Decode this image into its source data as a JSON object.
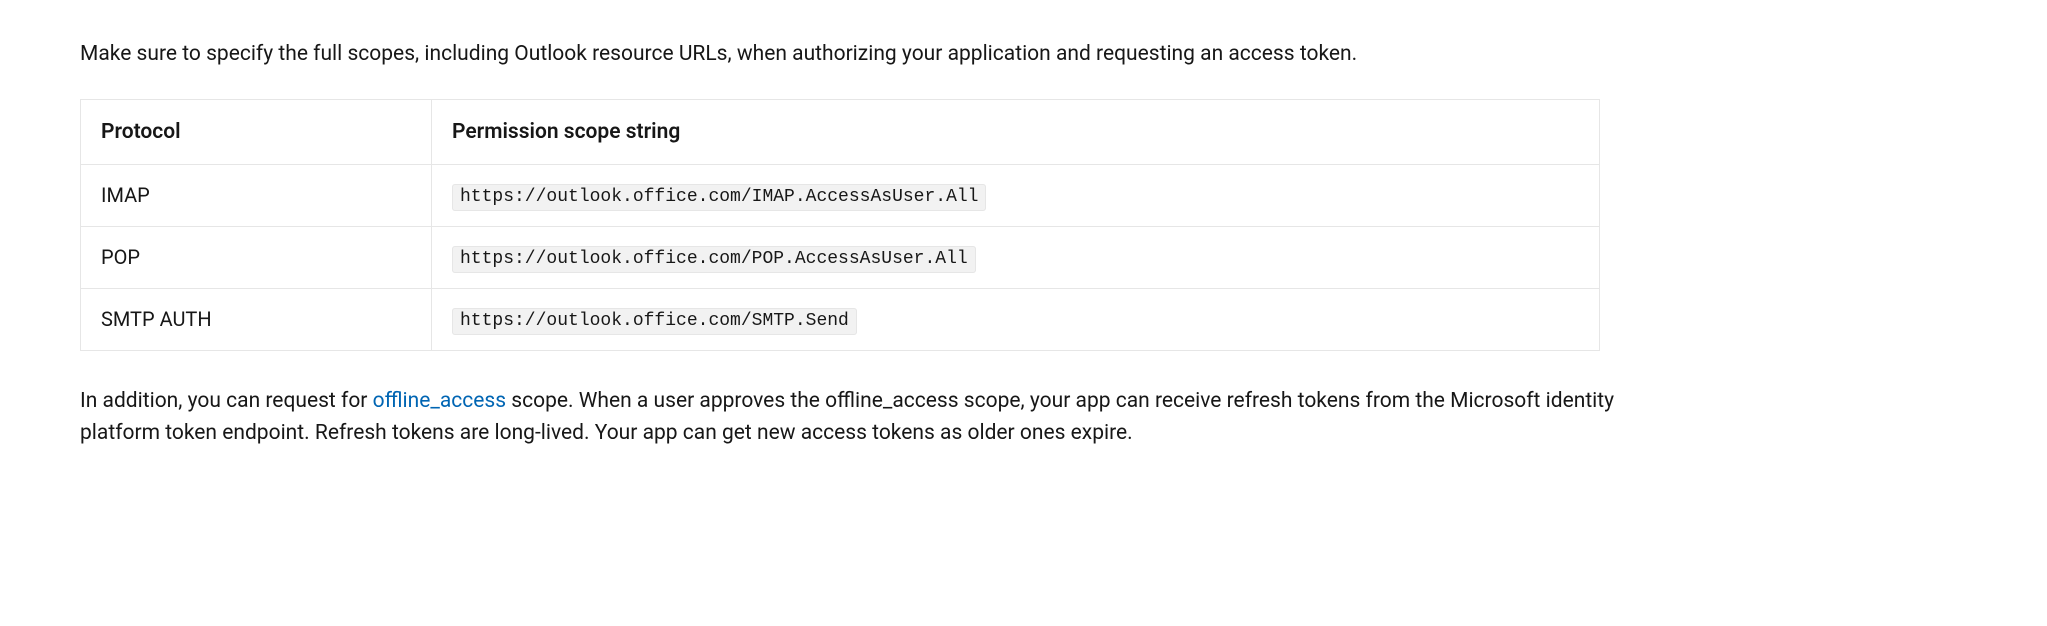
{
  "intro": "Make sure to specify the full scopes, including Outlook resource URLs, when authorizing your application and requesting an access token.",
  "table": {
    "headers": {
      "protocol": "Protocol",
      "scope": "Permission scope string"
    },
    "rows": [
      {
        "protocol": "IMAP",
        "scope": "https://outlook.office.com/IMAP.AccessAsUser.All"
      },
      {
        "protocol": "POP",
        "scope": "https://outlook.office.com/POP.AccessAsUser.All"
      },
      {
        "protocol": "SMTP AUTH",
        "scope": "https://outlook.office.com/SMTP.Send"
      }
    ]
  },
  "outro": {
    "pre_link": "In addition, you can request for ",
    "link_text": "offline_access",
    "link_href": "#",
    "post_link": " scope. When a user approves the offline_access scope, your app can receive refresh tokens from the Microsoft identity platform token endpoint. Refresh tokens are long-lived. Your app can get new access tokens as older ones expire."
  }
}
